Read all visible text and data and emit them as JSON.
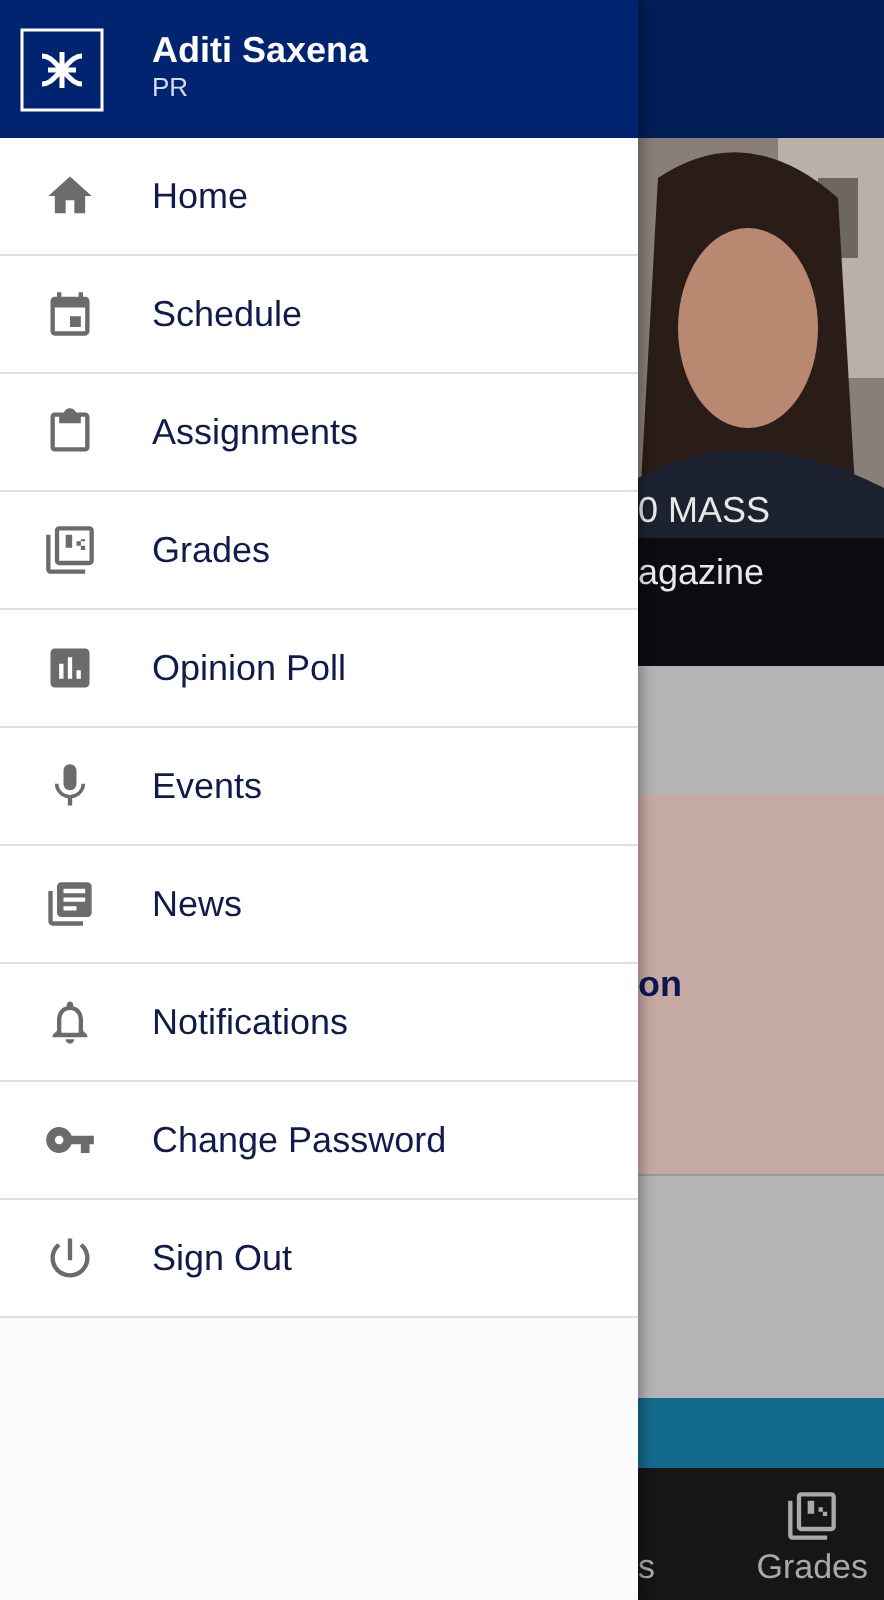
{
  "drawer": {
    "user_name": "Aditi Saxena",
    "user_role": "PR",
    "items": [
      {
        "label": "Home"
      },
      {
        "label": "Schedule"
      },
      {
        "label": "Assignments"
      },
      {
        "label": "Grades"
      },
      {
        "label": "Opinion Poll"
      },
      {
        "label": "Events"
      },
      {
        "label": "News"
      },
      {
        "label": "Notifications"
      },
      {
        "label": "Change Password"
      },
      {
        "label": "Sign Out"
      }
    ]
  },
  "background": {
    "banner_lines": [
      "0 MASS",
      "agazine"
    ],
    "card_text": "on",
    "bottom_nav": [
      {
        "label": "s"
      },
      {
        "label": "Grades"
      }
    ]
  }
}
